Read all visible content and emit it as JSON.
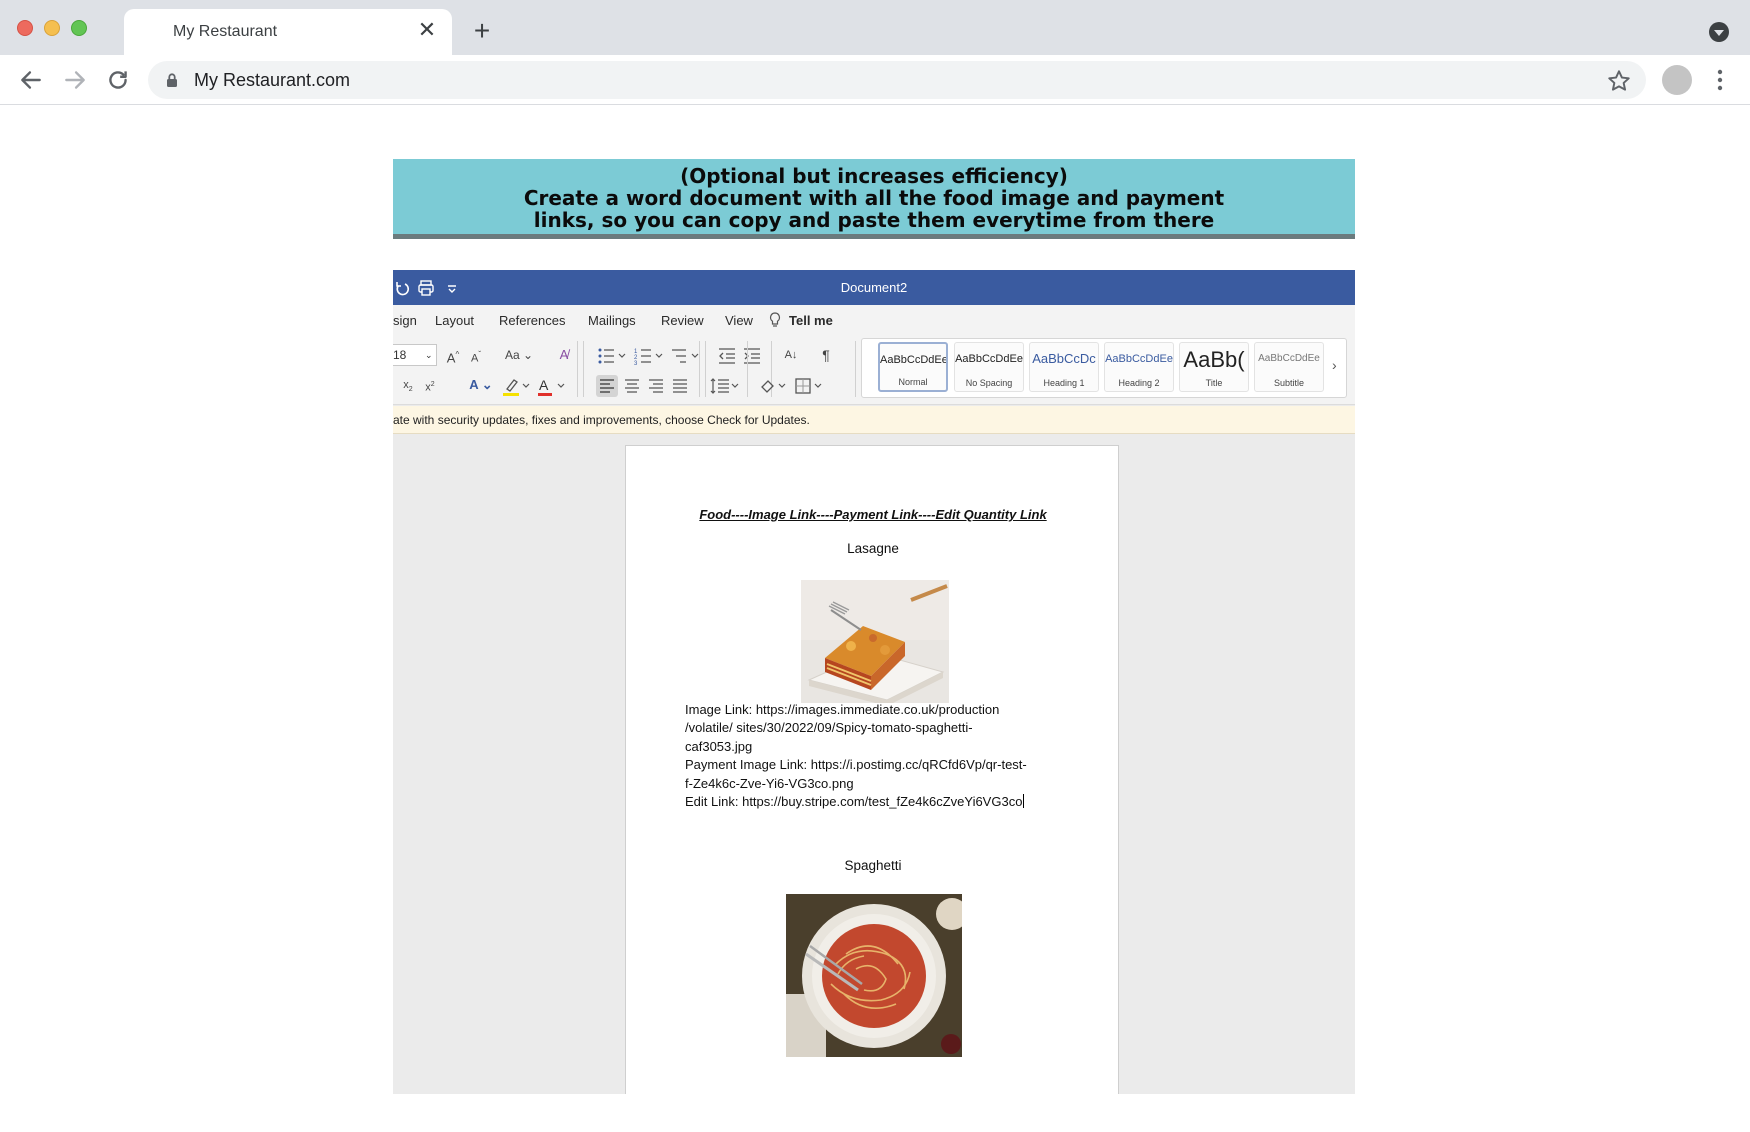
{
  "browser": {
    "tab_title": "My Restaurant",
    "url": "My Restaurant.com"
  },
  "banner": {
    "lines": [
      "(Optional but increases efficiency)",
      "Create a word document with all the food image and payment",
      "links, so you can copy and paste them everytime from there"
    ]
  },
  "word": {
    "doc_title": "Document2",
    "menu": [
      "sign",
      "Layout",
      "References",
      "Mailings",
      "Review",
      "View",
      "Tell me"
    ],
    "font_size": "18",
    "styles": [
      {
        "sample": "AaBbCcDdEe",
        "name": "Normal"
      },
      {
        "sample": "AaBbCcDdEe",
        "name": "No Spacing"
      },
      {
        "sample": "AaBbCcDc",
        "name": "Heading 1"
      },
      {
        "sample": "AaBbCcDdEe",
        "name": "Heading 2"
      },
      {
        "sample": "AaBb(",
        "name": "Title"
      },
      {
        "sample": "AaBbCcDdEe",
        "name": "Subtitle"
      }
    ],
    "update_message": "ate with security updates, fixes and improvements, choose Check for Updates.",
    "colors": {
      "titlebar": "#3a5ba0",
      "highlight": "#f5e100",
      "font_color": "#e0302a"
    }
  },
  "document": {
    "heading": "Food----Image Link----Payment Link----Edit Quantity Link",
    "items": [
      {
        "name": "Lasagne",
        "image_link_lines": [
          "Image Link: https://images.immediate.co.uk/production",
          "/volatile/ sites/30/2022/09/Spicy-tomato-spaghetti-",
          "caf3053.jpg"
        ],
        "payment_link_lines": [
          "Payment Image Link: https://i.postimg.cc/qRCfd6Vp/qr-test-",
          "f-Ze4k6c-Zve-Yi6-VG3co.png"
        ],
        "edit_link": "Edit Link: https://buy.stripe.com/test_fZe4k6cZveYi6VG3co"
      },
      {
        "name": "Spaghetti"
      }
    ]
  }
}
